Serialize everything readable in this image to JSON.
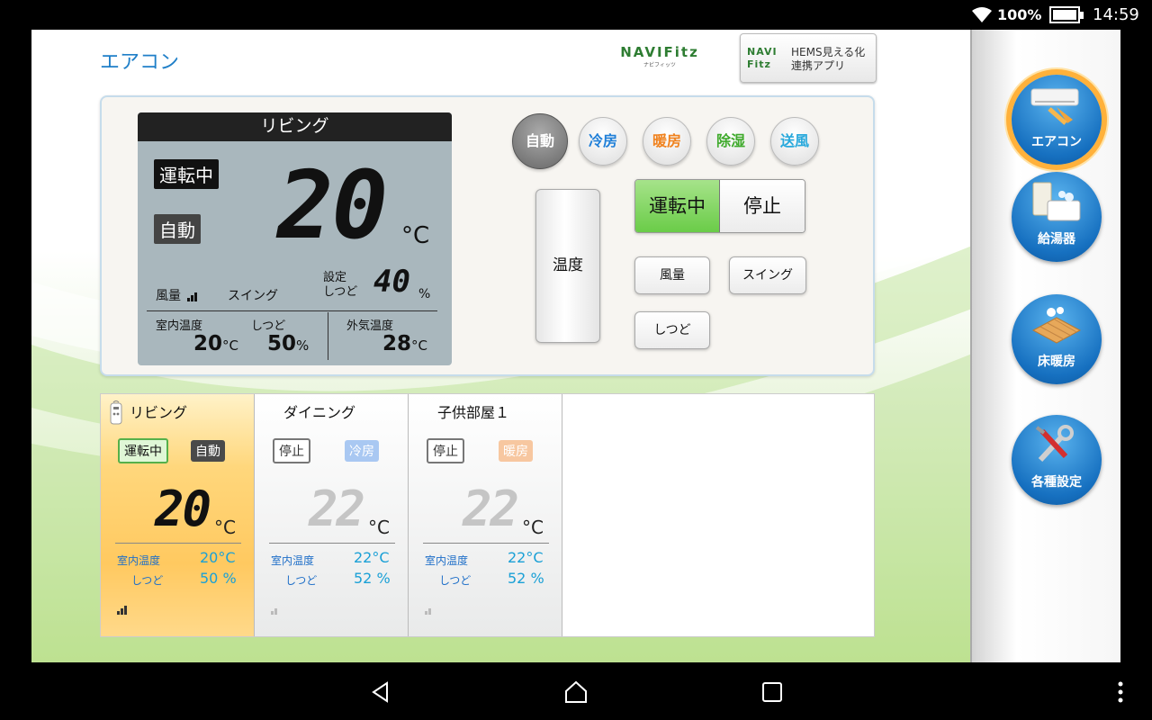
{
  "status": {
    "battery": "100%",
    "time": "14:59"
  },
  "header": {
    "title": "エアコン",
    "logo_main": "NAVIFitz",
    "logo_sub": "ナビフィッツ",
    "hems_mark_top": "NAVI",
    "hems_mark_bottom": "Fitz",
    "hems_line1": "HEMS見える化",
    "hems_line2": "連携アプリ"
  },
  "lcd": {
    "room": "リビング",
    "status": "運転中",
    "mode": "自動",
    "set_temp": "20",
    "temp_unit": "°C",
    "fan_label": "風量",
    "swing_label": "スイング",
    "set_humidity_label1": "設定",
    "set_humidity_label2": "しつど",
    "set_humidity": "40",
    "set_humidity_unit": "%",
    "indoor_temp_label": "室内温度",
    "humidity_label": "しつど",
    "outdoor_temp_label": "外気温度",
    "indoor_temp": "20",
    "indoor_temp_unit": "°C",
    "humidity": "50",
    "humidity_unit": "%",
    "outdoor_temp": "28",
    "outdoor_temp_unit": "°C"
  },
  "modes": [
    {
      "label": "自動",
      "color": "#ffffff"
    },
    {
      "label": "冷房",
      "color": "#1f7fd8"
    },
    {
      "label": "暖房",
      "color": "#f0821e"
    },
    {
      "label": "除湿",
      "color": "#3faa2c"
    },
    {
      "label": "送風",
      "color": "#29a9dc"
    }
  ],
  "controls": {
    "temp": "温度",
    "on": "運転中",
    "off": "停止",
    "fan": "風量",
    "swing": "スイング",
    "humidity": "しつど"
  },
  "rooms": [
    {
      "name": "リビング",
      "status": "運転中",
      "mode": "自動",
      "mode_color": "#4a4a4a",
      "temp": "20",
      "unit": "°C",
      "indoor_label": "室内温度",
      "indoor": "20°C",
      "humidity_label": "しつど",
      "humidity": "50 %",
      "selected": true
    },
    {
      "name": "ダイニング",
      "status": "停止",
      "mode": "冷房",
      "mode_color": "#a9c8f2",
      "temp": "22",
      "unit": "°C",
      "indoor_label": "室内温度",
      "indoor": "22°C",
      "humidity_label": "しつど",
      "humidity": "52 %",
      "selected": false
    },
    {
      "name": "子供部屋１",
      "status": "停止",
      "mode": "暖房",
      "mode_color": "#f7c7a0",
      "temp": "22",
      "unit": "°C",
      "indoor_label": "室内温度",
      "indoor": "22°C",
      "humidity_label": "しつど",
      "humidity": "52 %",
      "selected": false
    }
  ],
  "sidebar": [
    {
      "label": "エアコン",
      "icon": "air-conditioner-icon"
    },
    {
      "label": "給湯器",
      "icon": "water-heater-icon"
    },
    {
      "label": "床暖房",
      "icon": "floor-heating-icon"
    },
    {
      "label": "各種設定",
      "icon": "tools-icon"
    }
  ]
}
